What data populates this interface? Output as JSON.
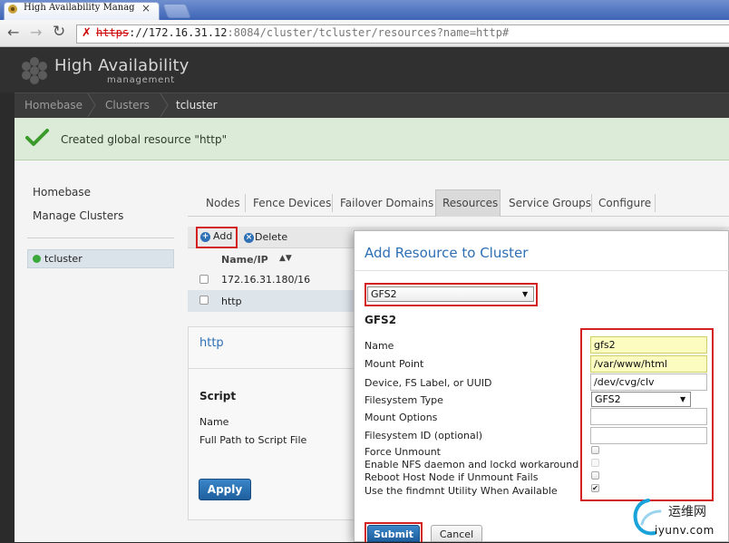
{
  "browser": {
    "tab_title": "High Availability Manag",
    "close_glyph": "×",
    "url_scheme": "https",
    "url_sep": "://",
    "url_host": "172.16.31.12",
    "url_port": ":8084",
    "url_path": "/cluster/tcluster/resources?name=http#"
  },
  "app": {
    "title": "High Availability",
    "subtitle": "management"
  },
  "breadcrumb": [
    "Homebase",
    "Clusters",
    "tcluster"
  ],
  "banner": {
    "message": "Created global resource \"http\""
  },
  "sidebar": {
    "links": [
      "Homebase",
      "Manage Clusters"
    ],
    "cluster": "tcluster"
  },
  "tabs": [
    "Nodes",
    "Fence Devices",
    "Failover Domains",
    "Resources",
    "Service Groups",
    "Configure"
  ],
  "resources": {
    "add_label": "Add",
    "delete_label": "Delete",
    "column_name": "Name/IP",
    "rows": [
      "172.16.31.180/16",
      "http"
    ],
    "detail_title": "http",
    "script_heading": "Script",
    "script_labels": [
      "Name",
      "Full Path to Script File"
    ],
    "apply_label": "Apply"
  },
  "modal": {
    "title": "Add Resource to Cluster",
    "resource_type": "GFS2",
    "form_heading": "GFS2",
    "labels": [
      "Name",
      "Mount Point",
      "Device, FS Label, or UUID",
      "Filesystem Type",
      "Mount Options",
      "Filesystem ID (optional)",
      "Force Unmount",
      "Enable NFS daemon and lockd workaround",
      "Reboot Host Node if Unmount Fails",
      "Use the findmnt Utility When Available"
    ],
    "values": {
      "name": "gfs2",
      "mount_point": "/var/www/html",
      "device": "/dev/cvg/clv",
      "fs_type": "GFS2",
      "mount_options": "",
      "fs_id": ""
    },
    "checkboxes": {
      "force_unmount": false,
      "nfs_workaround": false,
      "reboot_host": false,
      "use_findmnt": true
    },
    "check_glyph": "✔",
    "submit_label": "Submit",
    "cancel_label": "Cancel"
  },
  "watermark": {
    "cn": "运维网",
    "domain": "iyunv.com"
  },
  "colors": {
    "accent": "#2e6fb5",
    "highlight_border": "#d32020",
    "success": "#3aa83a"
  }
}
